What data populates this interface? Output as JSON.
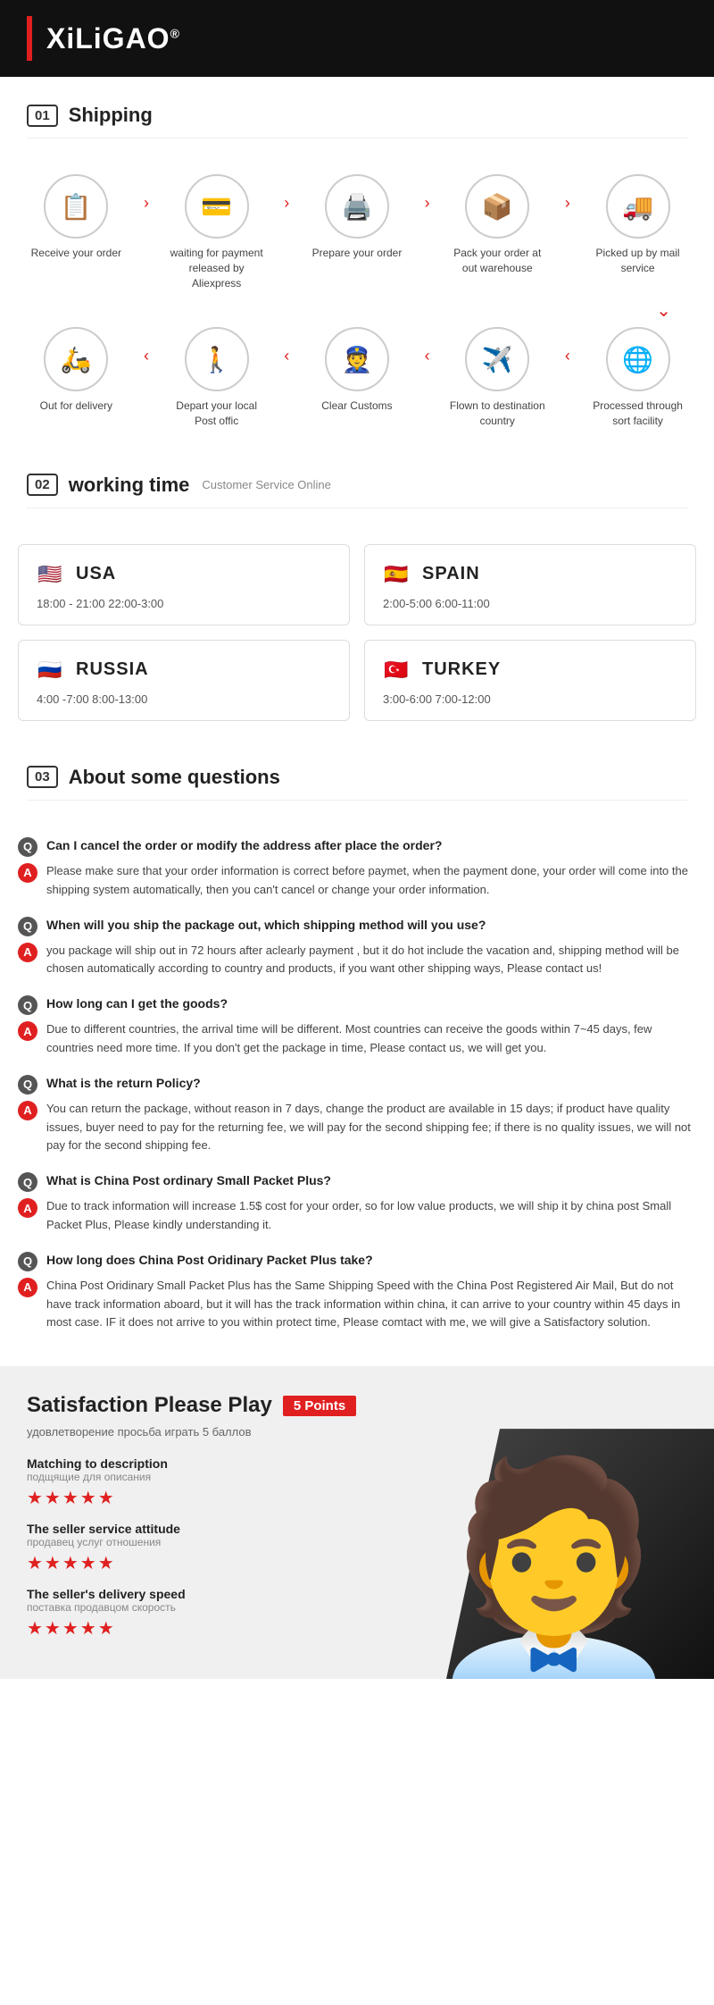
{
  "header": {
    "logo": "XiLiGAO",
    "trademark": "®"
  },
  "shipping": {
    "section_num": "01",
    "section_label": "Shipping",
    "row1": [
      {
        "icon": "📋",
        "label": "Receive your order"
      },
      {
        "arrow": ">"
      },
      {
        "icon": "💳",
        "label": "waiting for payment released by Aliexpress"
      },
      {
        "arrow": ">"
      },
      {
        "icon": "🖨️",
        "label": "Prepare your order"
      },
      {
        "arrow": ">"
      },
      {
        "icon": "📦",
        "label": "Pack your order at out warehouse"
      },
      {
        "arrow": ">"
      },
      {
        "icon": "🚚",
        "label": "Picked up by mail service"
      }
    ],
    "row2": [
      {
        "icon": "🛵",
        "label": "Out  for delivery"
      },
      {
        "arrow": "<"
      },
      {
        "icon": "🚶",
        "label": "Depart your local Post offic"
      },
      {
        "arrow": "<"
      },
      {
        "icon": "👮",
        "label": "Clear Customs"
      },
      {
        "arrow": "<"
      },
      {
        "icon": "✈️",
        "label": "Flown to destination country"
      },
      {
        "arrow": "<"
      },
      {
        "icon": "🌐",
        "label": "Processed through sort facility"
      }
    ]
  },
  "working_time": {
    "section_num": "02",
    "section_label": "working time",
    "subtitle": "Customer Service Online",
    "countries": [
      {
        "flag": "🇺🇸",
        "name": "USA",
        "hours": "18:00 - 21:00   22:00-3:00"
      },
      {
        "flag": "🇪🇸",
        "name": "SPAIN",
        "hours": "2:00-5:00   6:00-11:00"
      },
      {
        "flag": "🇷🇺",
        "name": "RUSSIA",
        "hours": "4:00 -7:00   8:00-13:00"
      },
      {
        "flag": "🇹🇷",
        "name": "TURKEY",
        "hours": "3:00-6:00   7:00-12:00"
      }
    ]
  },
  "faq": {
    "section_num": "03",
    "section_label": "About some questions",
    "items": [
      {
        "q": "Can I cancel the order or modify the address after place the order?",
        "a": "Please make sure that your order information is correct before paymet, when the payment done, your order will come into the shipping system automatically, then you can't cancel or change your order information."
      },
      {
        "q": "When will you ship the package out, which shipping method will you use?",
        "a": "you package will ship out in 72 hours after aclearly payment , but it do hot include the vacation and, shipping method will be chosen automatically according to country and products, if you want other shipping ways, Please contact us!"
      },
      {
        "q": "How long can I get the goods?",
        "a": "Due to different countries, the arrival time will be different. Most countries can receive the goods within 7~45 days, few countries need more time. If you don't get the package in time, Please contact us, we will get you."
      },
      {
        "q": "What is the return Policy?",
        "a": "You can return the package, without reason in 7 days, change the product are available in 15 days; if product have quality issues, buyer need to pay for the returning fee, we will pay for the second shipping fee; if there is no quality issues, we will not pay for the second shipping fee."
      },
      {
        "q": "What is China Post ordinary Small Packet Plus?",
        "a": "Due to track information will increase 1.5$ cost for your order, so for low value products, we will ship it by china post Small Packet Plus, Please kindly understanding it."
      },
      {
        "q": "How long does China Post Oridinary Packet Plus take?",
        "a": "China Post Oridinary Small Packet Plus has the Same Shipping Speed with the China Post Registered Air Mail, But do not have track information aboard, but it will has the track information within china, it can arrive to your country within 45 days in most case. IF it does not arrive to you within protect time, Please comtact with me, we will give a Satisfactory solution."
      }
    ]
  },
  "satisfaction": {
    "title": "Satisfaction Please Play",
    "badge": "5 Points",
    "subtitle": "удовлетворение просьба играть 5 баллов",
    "ratings": [
      {
        "label": "Matching to description",
        "sublabel": "подщящие для описания",
        "stars": "★★★★★"
      },
      {
        "label": "The seller service attitude",
        "sublabel": "продавец услуг отношения",
        "stars": "★★★★★"
      },
      {
        "label": "The seller's delivery speed",
        "sublabel": "поставка продавцом скорость",
        "stars": "★★★★★"
      }
    ]
  }
}
